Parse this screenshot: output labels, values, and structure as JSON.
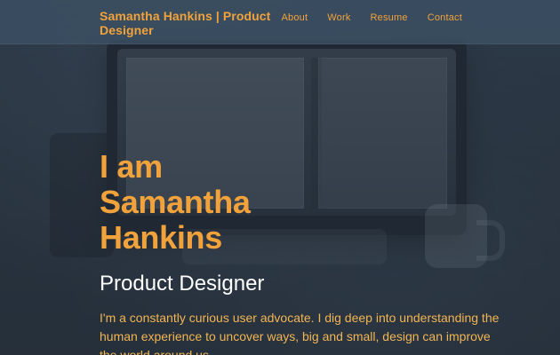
{
  "header": {
    "brand": "Samantha Hankins | Product Designer",
    "nav": [
      "About",
      "Work",
      "Resume",
      "Contact"
    ]
  },
  "hero": {
    "title_lines": [
      "I am",
      "Samantha",
      "Hankins"
    ],
    "role": "Product Designer",
    "blurb": "I'm a constantly curious user advocate. I dig deep into understanding the human experience to uncover ways, big and small, design can improve the world around us."
  },
  "colors": {
    "accent": "#f2a23a",
    "topbar_bg": "#3c5064",
    "overlay": "#222e3a",
    "text_primary": "#ffffff"
  }
}
